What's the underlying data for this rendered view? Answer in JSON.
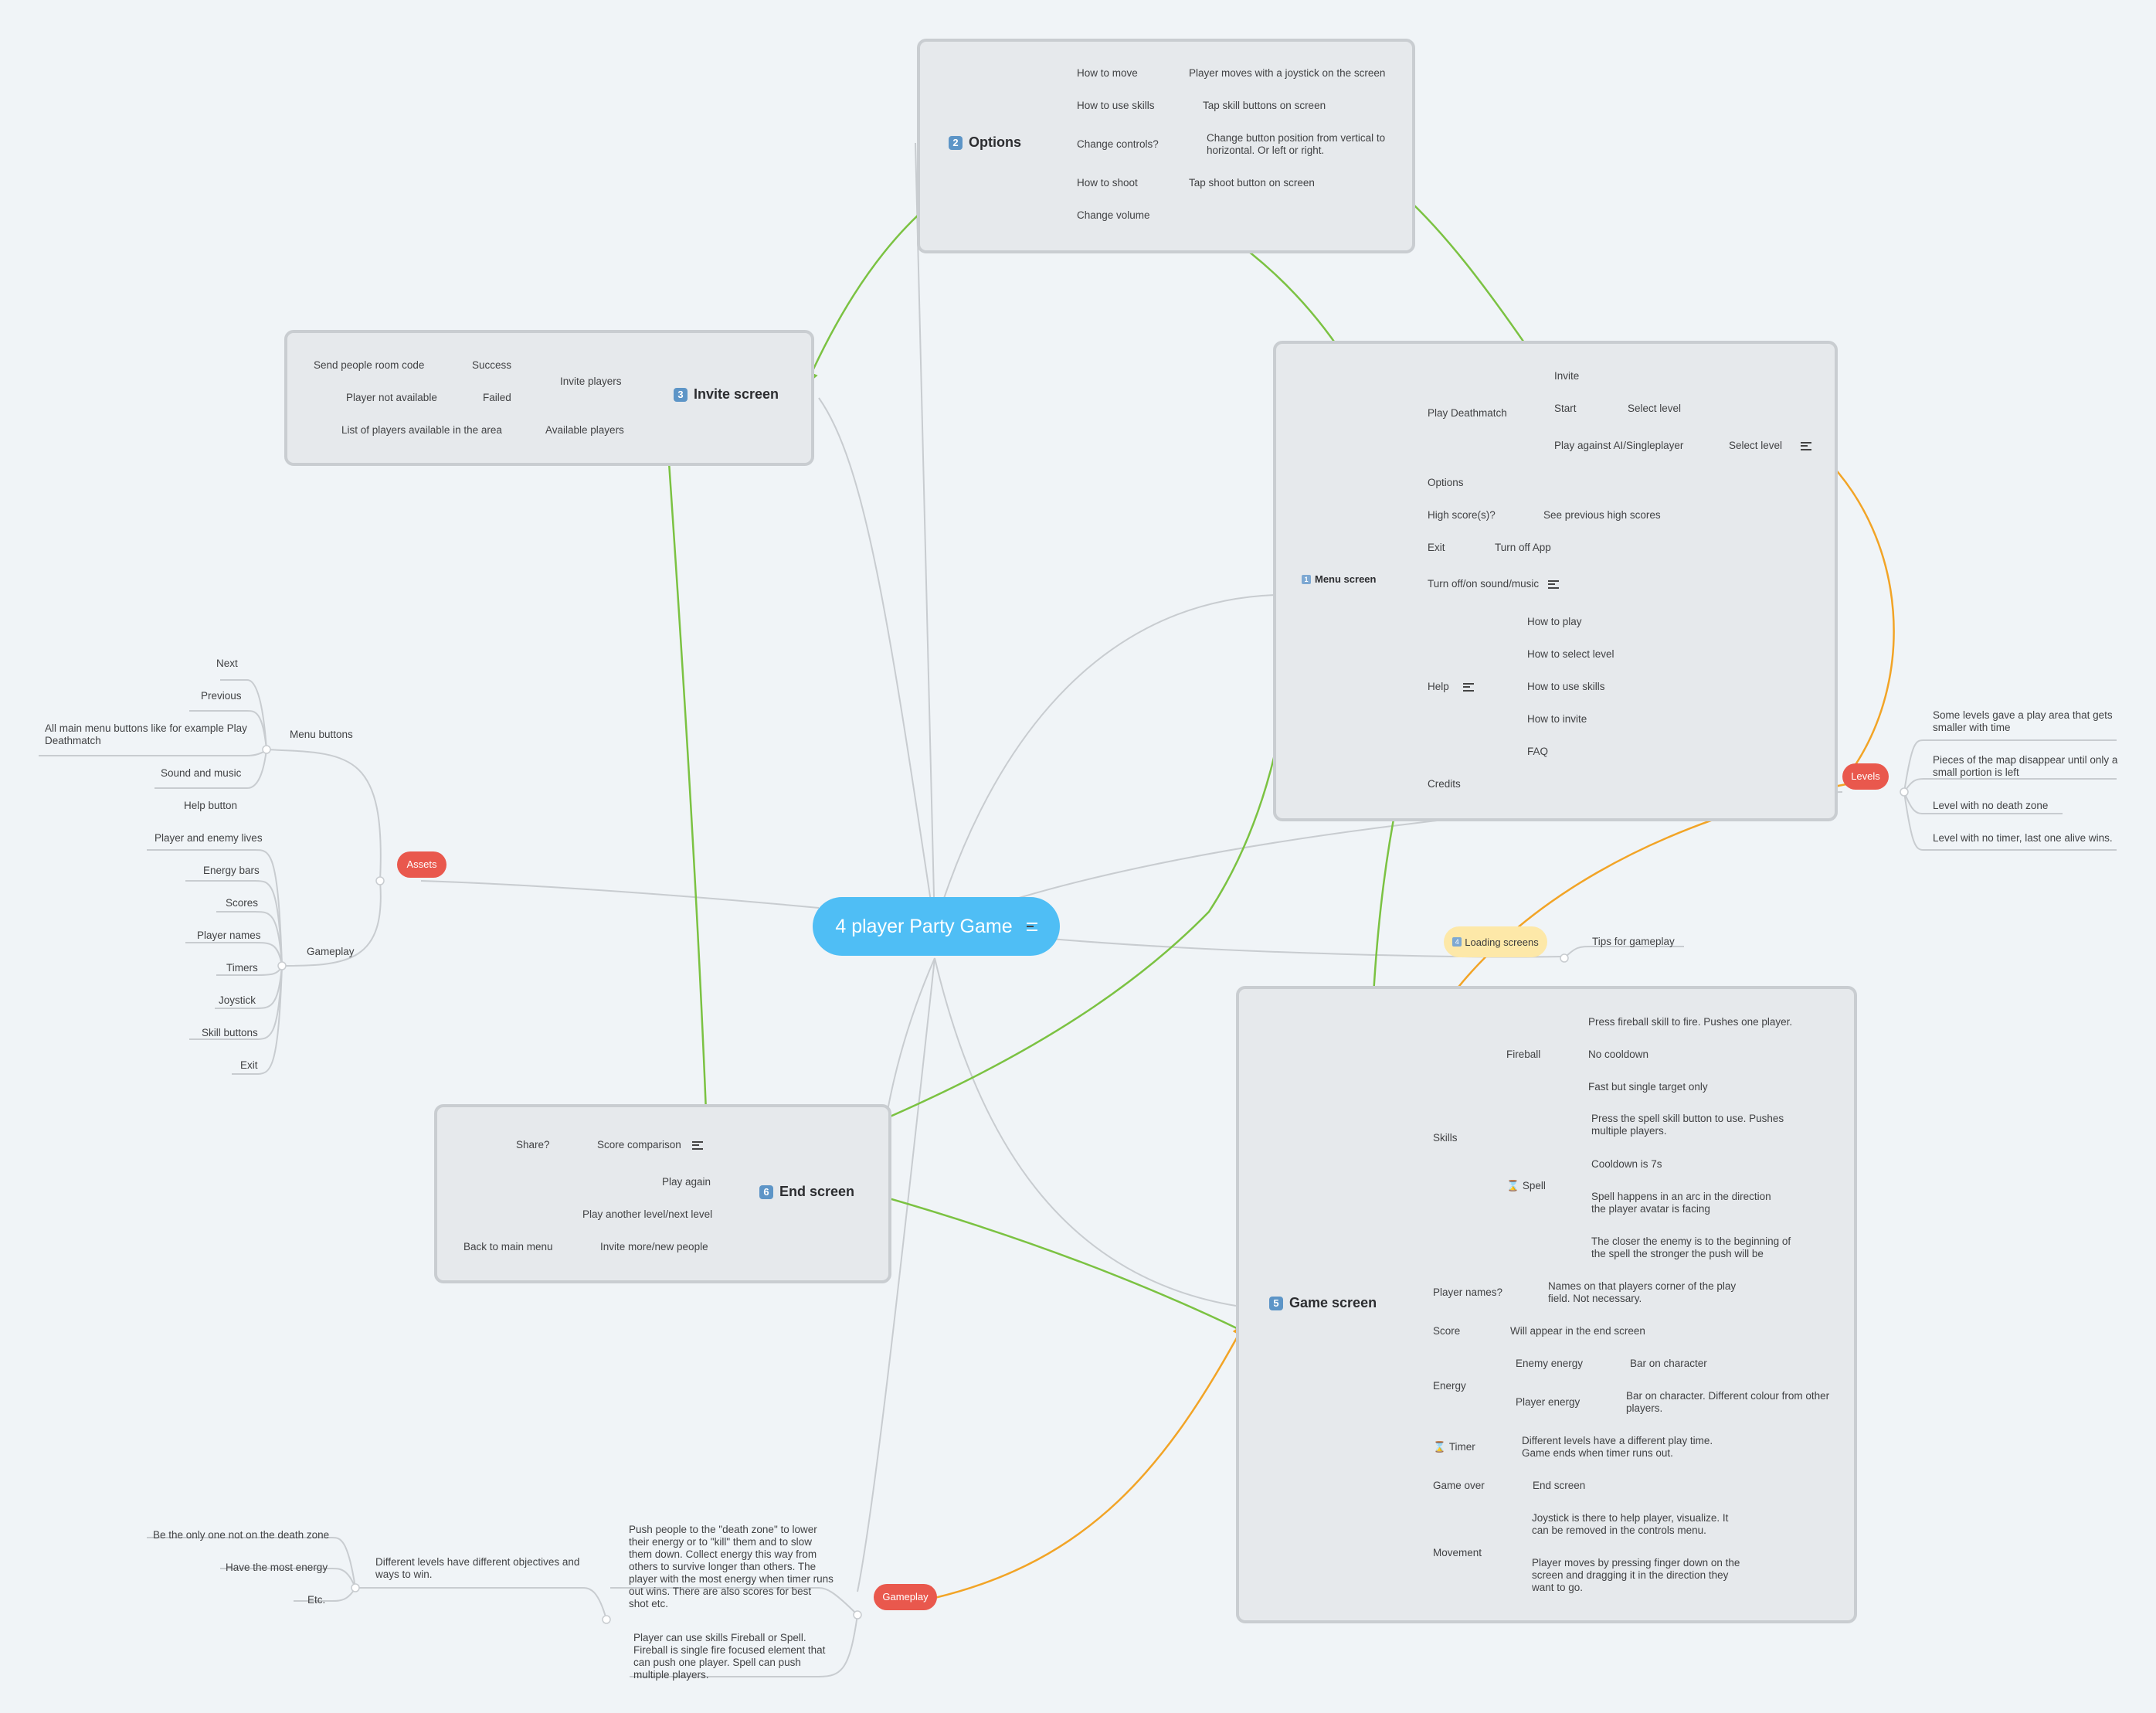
{
  "central": {
    "label": "4 player Party Game"
  },
  "options": {
    "title": "Options",
    "number": "2",
    "how_to_move": "How to move",
    "how_to_move_detail": "Player moves with a joystick on the screen",
    "how_to_use_skills": "How to use skills",
    "how_to_use_skills_detail": "Tap skill buttons on screen",
    "change_controls": "Change controls?",
    "change_controls_detail": "Change button position from vertical to horizontal. Or left or right.",
    "how_to_shoot": "How to shoot",
    "how_to_shoot_detail": "Tap shoot button on screen",
    "change_volume": "Change volume"
  },
  "invite": {
    "title": "Invite screen",
    "number": "3",
    "send_code": "Send people room code",
    "success": "Success",
    "invite_players": "Invite players",
    "not_available": "Player not available",
    "failed": "Failed",
    "list_players": "List of players available in the area",
    "available_players": "Available players"
  },
  "menu": {
    "title": "Menu screen",
    "number": "1",
    "invite": "Invite",
    "start": "Start",
    "select_level_1": "Select level",
    "play_deathmatch": "Play Deathmatch",
    "play_ai": "Play against AI/Singleplayer",
    "select_level_2": "Select level",
    "options": "Options",
    "high_scores": "High score(s)?",
    "see_scores": "See previous high scores",
    "exit": "Exit",
    "turn_off": "Turn off App",
    "sound": "Turn off/on sound/music",
    "help": "Help",
    "how_to_play": "How to play",
    "how_to_select": "How to select level",
    "how_to_skills": "How to use skills",
    "how_to_invite": "How to invite",
    "faq": "FAQ",
    "credits": "Credits"
  },
  "levels": {
    "label": "Levels",
    "items": [
      "Some levels gave a play area that gets smaller with time",
      "Pieces of the map disappear until only a small portion is left",
      "Level with no death zone",
      "Level with no timer, last one alive wins."
    ]
  },
  "loading": {
    "label": "Loading screens",
    "number": "4",
    "tips": "Tips for gameplay"
  },
  "assets": {
    "label": "Assets",
    "menu_buttons": "Menu buttons",
    "menu_items": [
      "Next",
      "Previous",
      "All main menu buttons like for example Play Deathmatch",
      "Sound and music",
      "Help button"
    ],
    "gameplay": "Gameplay",
    "gameplay_items": [
      "Player and enemy lives",
      "Energy bars",
      "Scores",
      "Player names",
      "Timers",
      "Joystick",
      "Skill buttons",
      "Exit"
    ]
  },
  "end": {
    "title": "End screen",
    "number": "6",
    "share": "Share?",
    "score_comparison": "Score comparison",
    "play_again": "Play again",
    "play_another": "Play another level/next level",
    "back_menu": "Back to main menu",
    "invite_more": "Invite more/new people"
  },
  "game": {
    "title": "Game screen",
    "number": "5",
    "skills": "Skills",
    "fireball": "Fireball",
    "fireball_items": [
      "Press fireball skill to fire. Pushes one player.",
      "No cooldown",
      "Fast but single target only"
    ],
    "spell": "Spell",
    "spell_items": [
      "Press the spell skill button to use. Pushes multiple players.",
      "Cooldown is 7s",
      "Spell happens in an arc in the direction the player avatar is facing",
      "The closer the enemy is to the beginning of the spell the stronger the push will be"
    ],
    "player_names": "Player names?",
    "player_names_detail": "Names on that players corner of the play field. Not necessary.",
    "score": "Score",
    "score_detail": "Will appear in the end screen",
    "energy": "Energy",
    "enemy_energy": "Enemy energy",
    "enemy_energy_detail": "Bar on character",
    "player_energy": "Player energy",
    "player_energy_detail": "Bar on character. Different colour from other players.",
    "timer": "Timer",
    "timer_detail": "Different levels have a different play time. Game ends when timer runs out.",
    "game_over": "Game over",
    "end_screen": "End screen",
    "movement": "Movement",
    "movement_items": [
      "Joystick is there to help player, visualize. It can be removed in the controls menu.",
      "Player moves by pressing finger down on the screen and dragging it in the direction they want to go."
    ]
  },
  "gameplay": {
    "label": "Gameplay",
    "push": "Push people to the \"death zone\" to lower their energy or to \"kill\" them and to slow them down. Collect energy this way from others to survive longer than others. The player with the most energy when timer runs out wins. There are also scores for best shot etc.",
    "skills": "Player can use skills Fireball or Spell. Fireball is single fire focused element that can push one player. Spell can push multiple players.",
    "objectives": "Different levels have different objectives and ways to win.",
    "objective_items": [
      "Be the only one not on the death zone",
      "Have the most energy",
      "Etc."
    ]
  },
  "colors": {
    "central": "#4fbef5",
    "red_tag": "#e9584d",
    "loading_tag": "#fde8a8",
    "relation_green": "#7bc242",
    "relation_orange": "#f2a426",
    "connector": "#c8ccd0"
  }
}
